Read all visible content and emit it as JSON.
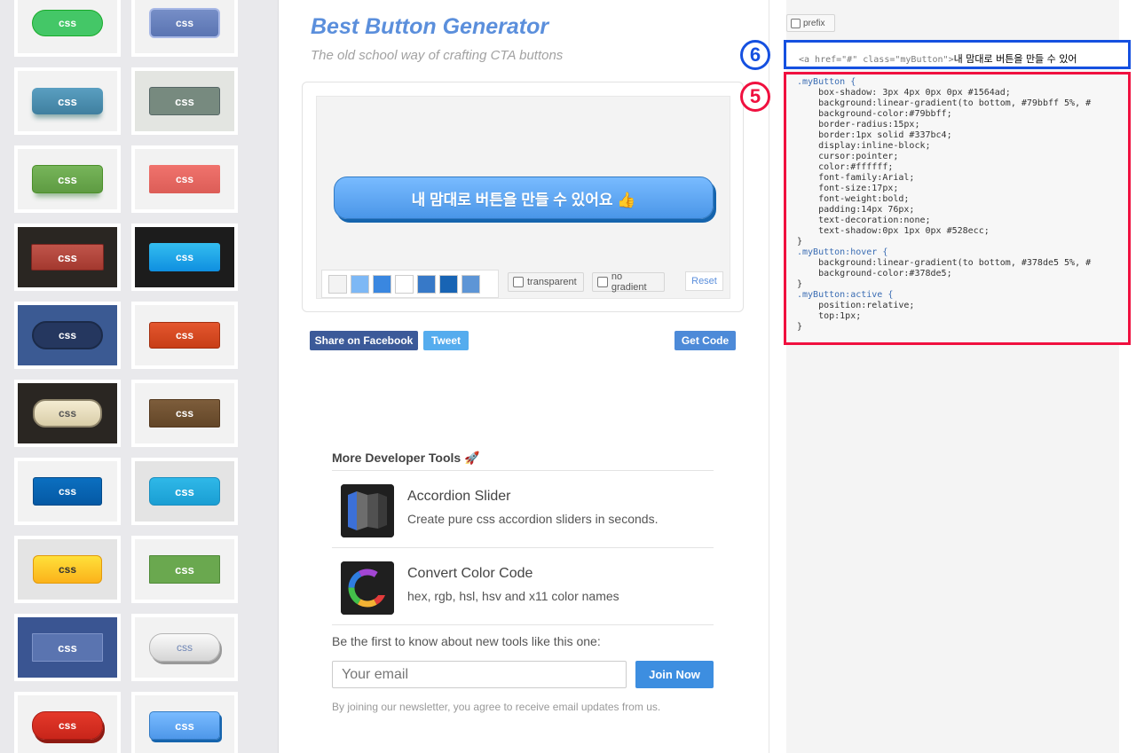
{
  "header": {
    "title": "Best Button Generator",
    "subtitle": "The old school way of crafting CTA buttons"
  },
  "gallery": {
    "button_label": "css",
    "tiles": [
      {
        "id": "green-pill",
        "style": "green rounded pill"
      },
      {
        "id": "blue-slate",
        "style": "slate blue rounded"
      },
      {
        "id": "teal-3d",
        "style": "teal raised"
      },
      {
        "id": "grey-green",
        "style": "grey-green flat"
      },
      {
        "id": "green-3d",
        "style": "green raised"
      },
      {
        "id": "salmon",
        "style": "salmon flat"
      },
      {
        "id": "red-dark",
        "style": "red on dark"
      },
      {
        "id": "blue-dark",
        "style": "bright blue on dark"
      },
      {
        "id": "navy-pill",
        "style": "navy pill on blue"
      },
      {
        "id": "orange-red",
        "style": "orange-red"
      },
      {
        "id": "cream-pill",
        "style": "cream pill on dark"
      },
      {
        "id": "brown",
        "style": "brown"
      },
      {
        "id": "blue-flat",
        "style": "blue flat"
      },
      {
        "id": "cyan",
        "style": "cyan"
      },
      {
        "id": "yellow",
        "style": "yellow"
      },
      {
        "id": "green-flat",
        "style": "green flat"
      },
      {
        "id": "blue-inset",
        "style": "blue inset on blue"
      },
      {
        "id": "silver-pill",
        "style": "silver pill"
      },
      {
        "id": "red-pill",
        "style": "red pill"
      },
      {
        "id": "blue-3d",
        "style": "blue raised"
      }
    ]
  },
  "preview": {
    "button_text": "내 맘대로 버튼을 만들 수 있어요 👍",
    "swatch_colors": [
      "#f3f3f3",
      "#7db8f5",
      "#3a87e0",
      "#ffffff",
      "#3779c8",
      "#1864b4",
      "#5d95d6"
    ],
    "transparent_label": "transparent",
    "no_gradient_label": "no gradient",
    "reset_label": "Reset"
  },
  "actions": {
    "facebook_label": "Share on Facebook",
    "tweet_label": "Tweet",
    "get_code_label": "Get Code",
    "facebook_color": "#3c5a99",
    "tweet_color": "#55acee",
    "get_code_color": "#4d8ad8"
  },
  "more_tools": {
    "heading": "More Developer Tools 🚀",
    "items": [
      {
        "name": "Accordion Slider",
        "desc": "Create pure css accordion sliders in seconds.",
        "icon": "accordion-slider-icon"
      },
      {
        "name": "Convert Color Code",
        "desc": "hex, rgb, hsl, hsv and x11 color names",
        "icon": "color-wheel-icon"
      }
    ]
  },
  "newsletter": {
    "text": "Be the first to know about new tools like this one:",
    "placeholder": "Your email",
    "button": "Join Now",
    "note": "By joining our newsletter, you agree to receive email updates from us."
  },
  "code": {
    "prefix_label": "prefix",
    "html_snippet": {
      "open": "<a href=\"#\" class=\"myButton\">",
      "text": "내 맘대로 버튼을 만들 수 있어"
    },
    "css_lines": [
      ".myButton {",
      "\tbox-shadow: 3px 4px 0px 0px #1564ad;",
      "\tbackground:linear-gradient(to bottom, #79bbff 5%, #",
      "\tbackground-color:#79bbff;",
      "\tborder-radius:15px;",
      "\tborder:1px solid #337bc4;",
      "\tdisplay:inline-block;",
      "\tcursor:pointer;",
      "\tcolor:#ffffff;",
      "\tfont-family:Arial;",
      "\tfont-size:17px;",
      "\tfont-weight:bold;",
      "\tpadding:14px 76px;",
      "\ttext-decoration:none;",
      "\ttext-shadow:0px 1px 0px #528ecc;",
      "}",
      ".myButton:hover {",
      "\tbackground:linear-gradient(to bottom, #378de5 5%, #",
      "\tbackground-color:#378de5;",
      "}",
      ".myButton:active {",
      "\tposition:relative;",
      "\ttop:1px;",
      "}"
    ]
  },
  "annotations": {
    "marker_6": "6",
    "marker_5": "5",
    "marker_6_color": "#1550e0",
    "marker_5_color": "#f0103f"
  }
}
